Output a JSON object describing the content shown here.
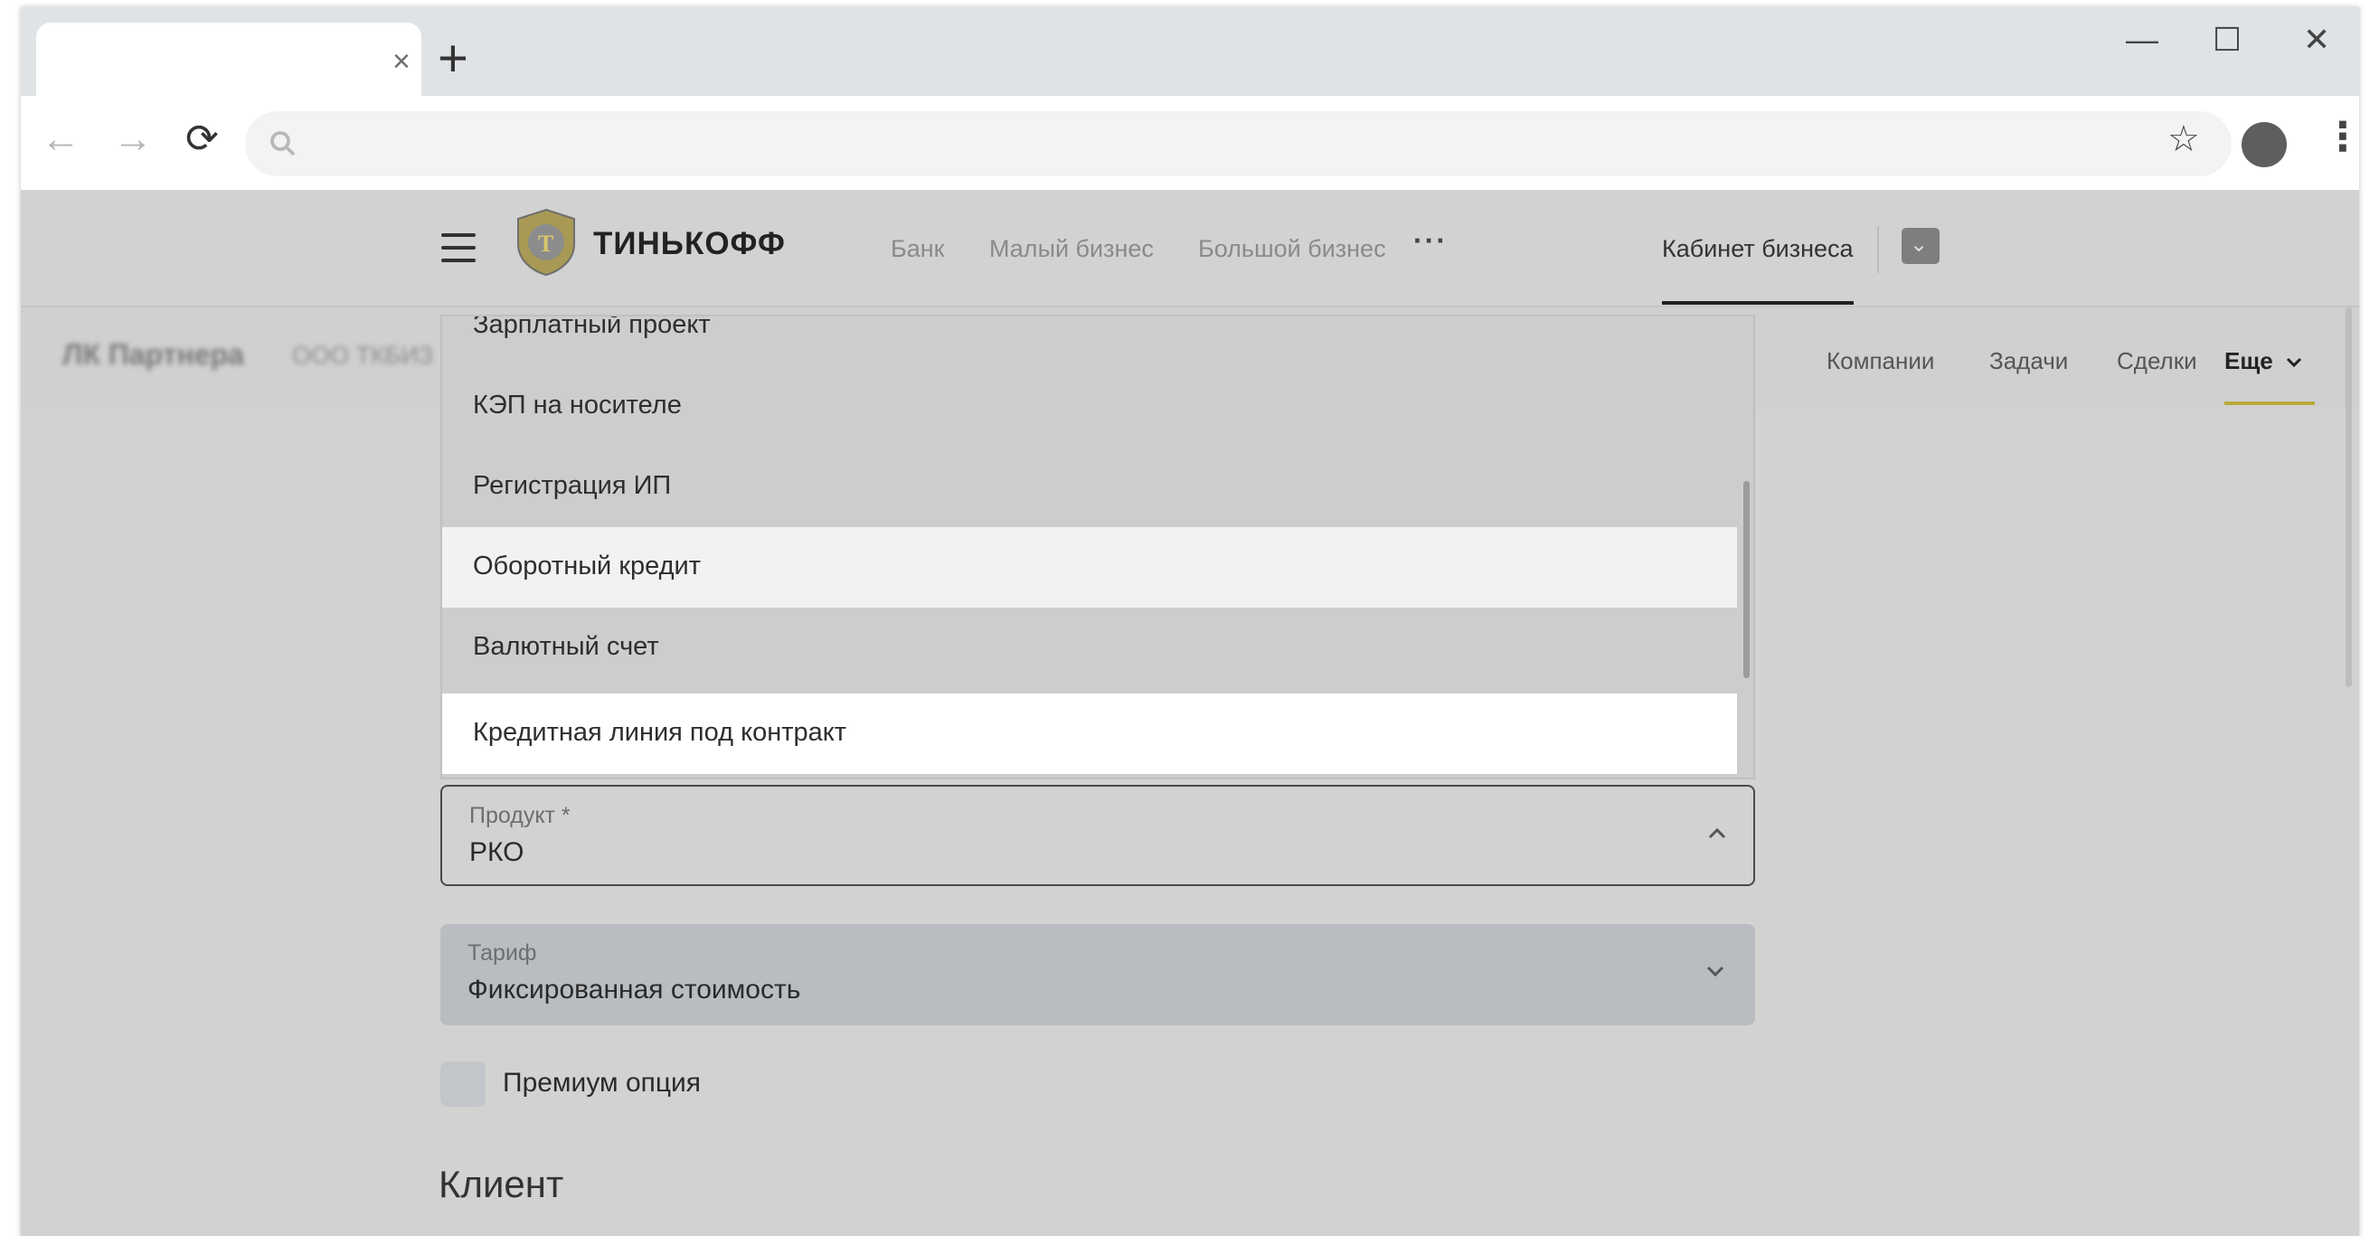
{
  "browser": {
    "tab_title": "",
    "tab_close": "×",
    "new_tab": "+",
    "address": "",
    "controls": {
      "minimize": "—",
      "maximize": "☐",
      "close": "✕"
    },
    "nav": {
      "back": "←",
      "forward": "→",
      "reload": "⟳"
    },
    "star": "☆",
    "menu": "⋮"
  },
  "header": {
    "logo_text": "ТИНЬКОФФ",
    "nav_links": [
      "Банк",
      "Малый бизнес",
      "Большой бизнес"
    ],
    "more": "···",
    "cabinet": "Кабинет бизнеса"
  },
  "subheader": {
    "title": "ЛК Партнера",
    "org": "ООО ТКБИЗ",
    "links": [
      "Компании",
      "Задачи",
      "Сделки"
    ],
    "more_label": "Еще"
  },
  "dropdown": {
    "items": [
      {
        "label": "Зарплатный проект",
        "state": "normal"
      },
      {
        "label": "КЭП на носителе",
        "state": "normal"
      },
      {
        "label": "Регистрация ИП",
        "state": "normal"
      },
      {
        "label": "Оборотный кредит",
        "state": "hover"
      },
      {
        "label": "Валютный счет",
        "state": "normal"
      },
      {
        "label": "Кредитная линия под контракт",
        "state": "selected"
      }
    ]
  },
  "form": {
    "product": {
      "label": "Продукт *",
      "value": "РКО"
    },
    "tariff": {
      "label": "Тариф",
      "value": "Фиксированная стоимость"
    },
    "premium": {
      "label": "Премиум опция",
      "checked": false
    }
  },
  "section": {
    "client_title": "Клиент"
  },
  "colors": {
    "brand_yellow": "#ffdd2d",
    "overlay": "#d2d2d2",
    "hover_row": "#f2f2f2",
    "selected_row": "#ffffff"
  }
}
